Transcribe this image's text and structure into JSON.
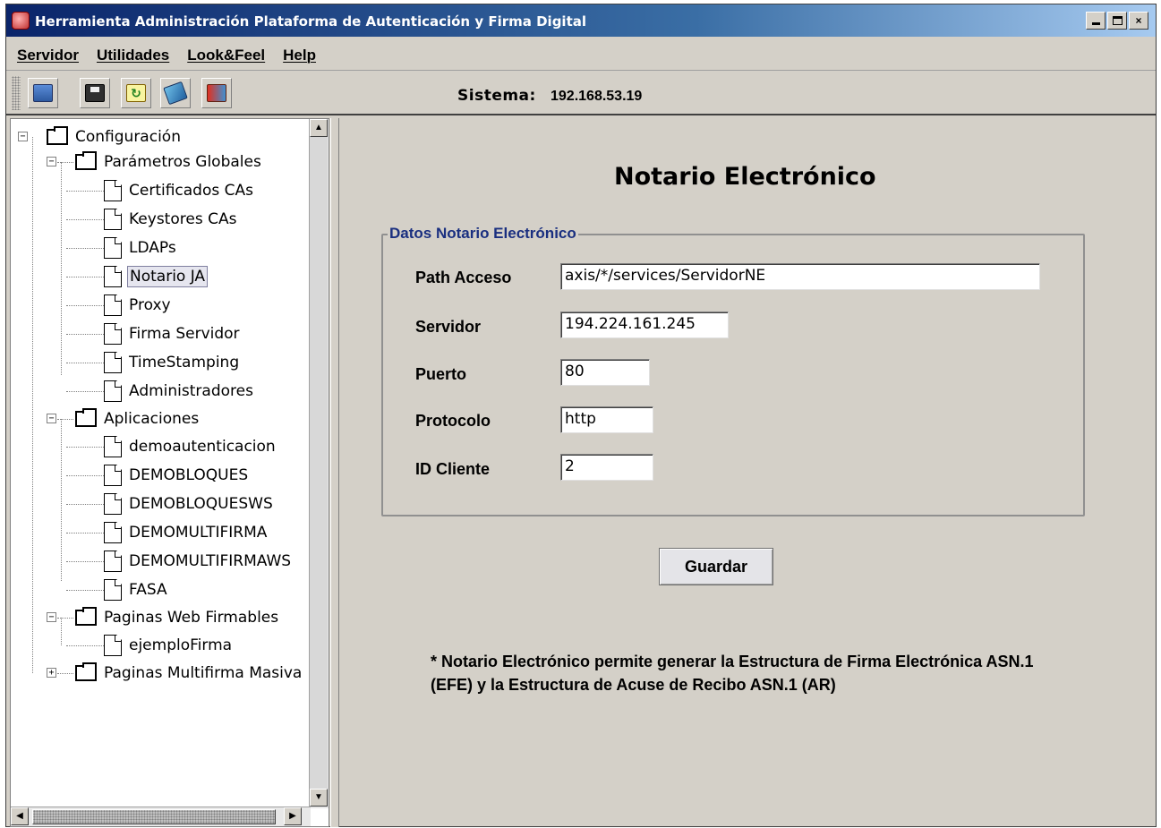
{
  "window": {
    "title": "Herramienta Administración Plataforma de Autenticación y Firma Digital",
    "min_glyph": "_",
    "max_glyph": "□",
    "close_glyph": "×"
  },
  "menu": [
    "Servidor",
    "Utilidades",
    "Look&Feel",
    "Help"
  ],
  "toolbar": {
    "icons": [
      "server-icon",
      "save-icon",
      "refresh-icon",
      "book-icon",
      "exit-icon"
    ],
    "system_label": "Sistema:",
    "system_value": "192.168.53.19"
  },
  "tree": {
    "items": [
      {
        "label": "Configuración",
        "type": "folder",
        "expanded": true
      },
      {
        "label": "Parámetros Globales",
        "type": "folder",
        "expanded": true
      },
      {
        "label": "Certificados CAs",
        "type": "leaf"
      },
      {
        "label": "Keystores CAs",
        "type": "leaf"
      },
      {
        "label": "LDAPs",
        "type": "leaf"
      },
      {
        "label": "Notario JA",
        "type": "leaf",
        "selected": true
      },
      {
        "label": "Proxy",
        "type": "leaf"
      },
      {
        "label": "Firma Servidor",
        "type": "leaf"
      },
      {
        "label": "TimeStamping",
        "type": "leaf"
      },
      {
        "label": "Administradores",
        "type": "leaf"
      },
      {
        "label": "Aplicaciones",
        "type": "folder",
        "expanded": true
      },
      {
        "label": "demoautenticacion",
        "type": "leaf"
      },
      {
        "label": "DEMOBLOQUES",
        "type": "leaf"
      },
      {
        "label": "DEMOBLOQUESWS",
        "type": "leaf"
      },
      {
        "label": "DEMOMULTIFIRMA",
        "type": "leaf"
      },
      {
        "label": "DEMOMULTIFIRMAWS",
        "type": "leaf"
      },
      {
        "label": "FASA",
        "type": "leaf"
      },
      {
        "label": "Paginas Web Firmables",
        "type": "folder",
        "expanded": true
      },
      {
        "label": "ejemploFirma",
        "type": "leaf"
      },
      {
        "label": "Paginas Multifirma Masiva",
        "type": "folder",
        "expanded": false
      }
    ],
    "expand_glyph": "+",
    "collapse_glyph": "−",
    "scroll_up": "▲",
    "scroll_down": "▼",
    "scroll_left": "◀",
    "scroll_right": "▶"
  },
  "form": {
    "title": "Notario Electrónico",
    "group_title": "Datos Notario Electrónico",
    "fields": [
      {
        "label": "Path Acceso",
        "value": "axis/*/services/ServidorNE"
      },
      {
        "label": "Servidor",
        "value": "194.224.161.245"
      },
      {
        "label": "Puerto",
        "value": "80"
      },
      {
        "label": "Protocolo",
        "value": "http"
      },
      {
        "label": "ID Cliente",
        "value": "2"
      }
    ],
    "save_label": "Guardar",
    "note_line1": "* Notario Electrónico permite generar la Estructura de Firma Electrónica ASN.1",
    "note_line2": "(EFE) y la Estructura de Acuse de Recibo ASN.1 (AR)"
  }
}
